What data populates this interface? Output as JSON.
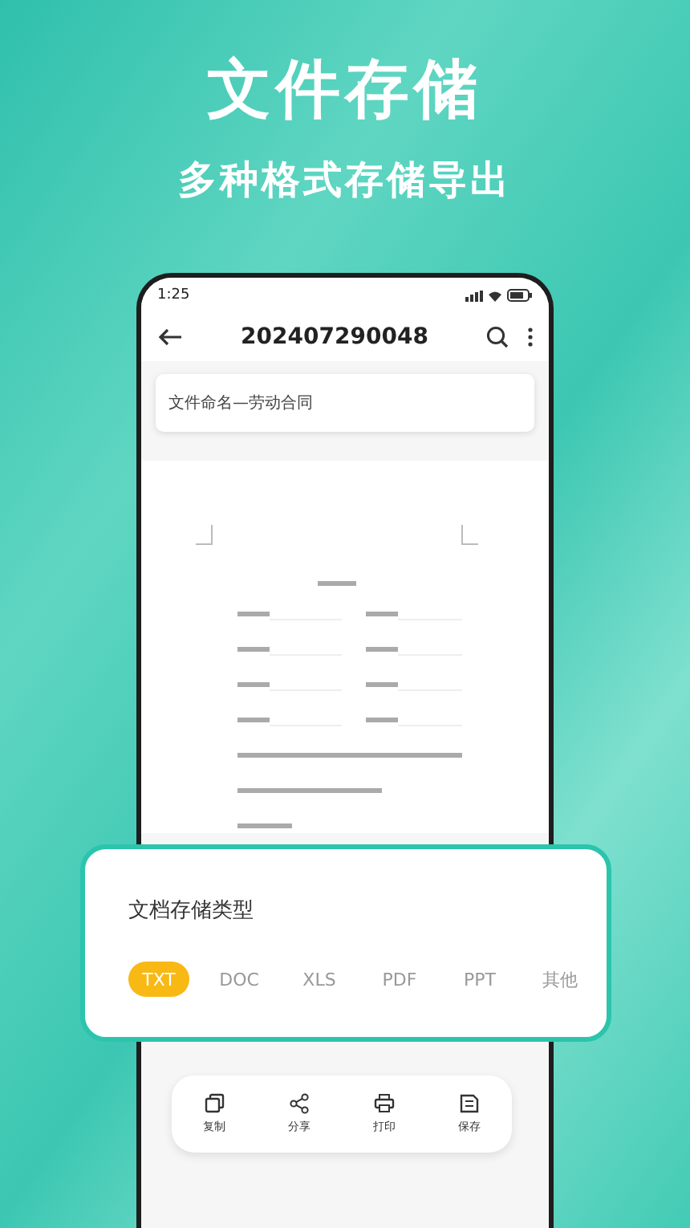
{
  "headline": "文件存储",
  "subheadline": "多种格式存储导出",
  "status_bar": {
    "time": "1:25"
  },
  "app_bar": {
    "title": "202407290048"
  },
  "name_field": {
    "value": "文件命名—劳动合同"
  },
  "format_sheet": {
    "title": "文档存储类型",
    "formats": [
      {
        "label": "TXT",
        "selected": true
      },
      {
        "label": "DOC",
        "selected": false
      },
      {
        "label": "XLS",
        "selected": false
      },
      {
        "label": "PDF",
        "selected": false
      },
      {
        "label": "PPT",
        "selected": false
      },
      {
        "label": "其他",
        "selected": false
      }
    ]
  },
  "toolbar": [
    {
      "label": "复制",
      "kind": "copy"
    },
    {
      "label": "分享",
      "kind": "share"
    },
    {
      "label": "打印",
      "kind": "print"
    },
    {
      "label": "保存",
      "kind": "save"
    }
  ]
}
